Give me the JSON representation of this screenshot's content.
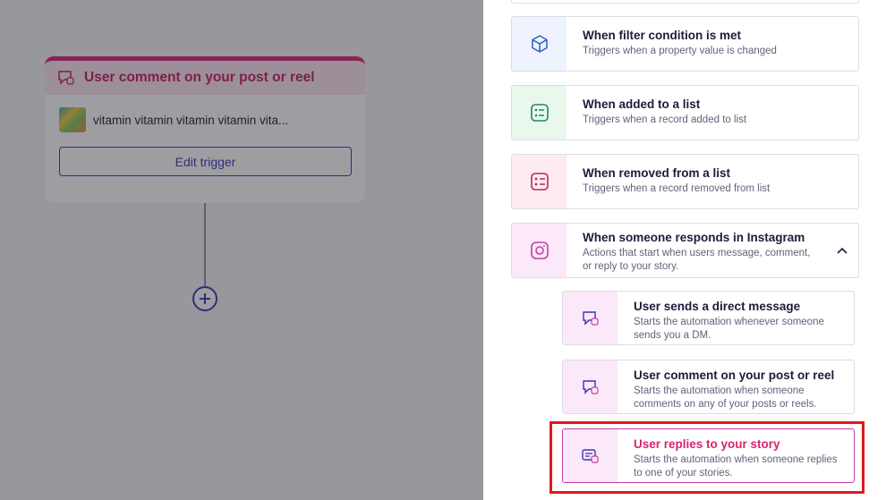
{
  "canvas": {
    "trigger_card": {
      "title": "User comment on your post or reel",
      "post_text": "vitamin vitamin vitamin vitamin vita...",
      "edit_button": "Edit trigger"
    }
  },
  "panel": {
    "options": [
      {
        "title": "When filter condition is met",
        "desc": "Triggers when a property value is changed",
        "icon": "cube-icon"
      },
      {
        "title": "When added to a list",
        "desc": "Triggers when a record added to list",
        "icon": "list-add-icon"
      },
      {
        "title": "When removed from a list",
        "desc": "Triggers when a record removed from list",
        "icon": "list-remove-icon"
      },
      {
        "title": "When someone responds in Instagram",
        "desc": "Actions that start when users message, comment, or reply to your story.",
        "icon": "instagram-icon"
      }
    ],
    "sub_options": [
      {
        "title": "User sends a direct message",
        "desc": "Starts the automation whenever someone sends you a DM.",
        "icon": "direct-message-icon"
      },
      {
        "title": "User comment on your post or reel",
        "desc": "Starts the automation when someone comments on any of your posts or reels.",
        "icon": "comment-icon"
      },
      {
        "title": "User replies to your story",
        "desc": "Starts the automation when someone replies to one of your stories.",
        "icon": "story-reply-icon"
      }
    ]
  },
  "colors": {
    "accent": "#d6246e",
    "primary": "#3a32b8",
    "highlight": "#e0191f"
  }
}
